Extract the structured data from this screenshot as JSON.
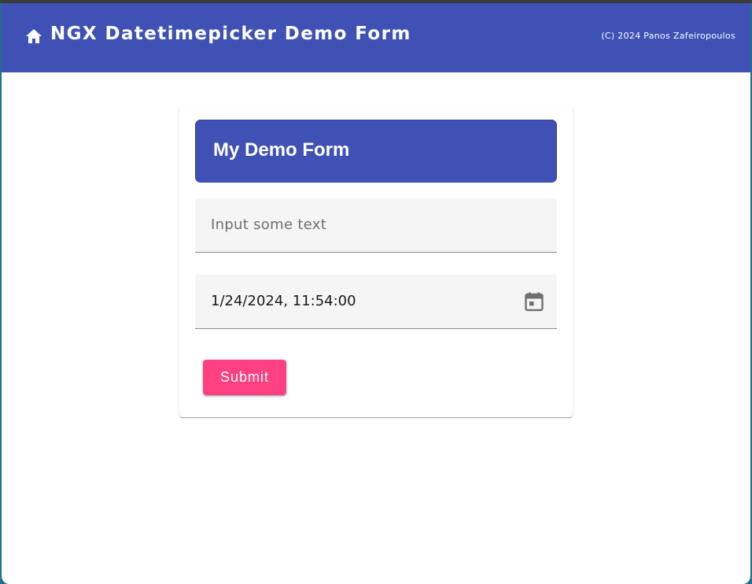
{
  "toolbar": {
    "home_icon": "home-icon",
    "title": "NGX Datetimepicker Demo Form",
    "copyright": "(C) 2024 Panos Zafeiropoulos",
    "background": "#3f51b5"
  },
  "form": {
    "title": "My Demo Form",
    "text_input": {
      "value": "",
      "placeholder": "Input some text"
    },
    "datetime_input": {
      "value": "1/24/2024, 11:54:00",
      "icon": "calendar-icon"
    },
    "submit_label": "Submit",
    "submit_color": "#ff4081"
  }
}
